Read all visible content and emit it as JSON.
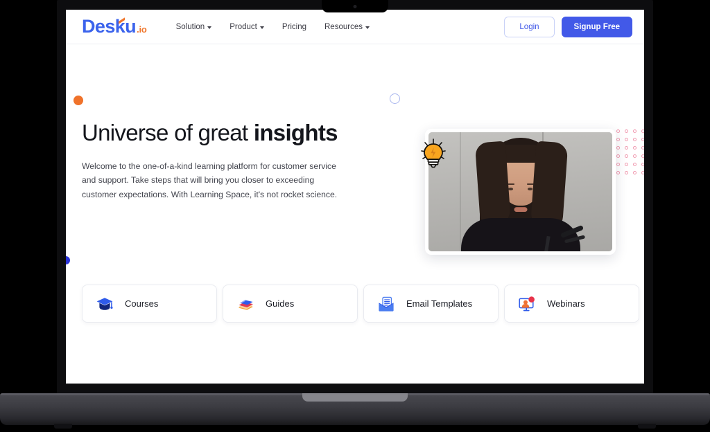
{
  "browser": {
    "device": "laptop-mockup"
  },
  "header": {
    "logo": {
      "main": "Des",
      "k": "k",
      "tail": "u",
      "suffix": ".io"
    },
    "nav": [
      {
        "label": "Solution",
        "has_caret": true
      },
      {
        "label": "Product",
        "has_caret": true
      },
      {
        "label": "Pricing",
        "has_caret": false
      },
      {
        "label": "Resources",
        "has_caret": true
      }
    ],
    "login_label": "Login",
    "signup_label": "Signup Free"
  },
  "hero": {
    "title_regular": "Universe of great ",
    "title_bold": "insights",
    "paragraph": "Welcome to the one-of-a-kind learning platform for customer service and support. Take steps that will bring you closer to exceeding customer expectations. With Learning Space, it's not rocket science."
  },
  "media": {
    "type": "video-thumbnail",
    "description": "Woman speaking at a podium with a microphone",
    "sticker": "lightbulb-icon"
  },
  "resource_cards": [
    {
      "label": "Courses",
      "icon": "graduation-cap-icon"
    },
    {
      "label": "Guides",
      "icon": "books-stack-icon"
    },
    {
      "label": "Email Templates",
      "icon": "email-envelope-icon"
    },
    {
      "label": "Webinars",
      "icon": "webinar-monitor-icon"
    }
  ],
  "decorations": {
    "orange_dot": "#f0722a",
    "blue_dot": "#2a33d8",
    "blue_ring": "#a9b6ee",
    "dot_grid": "#f09ab0"
  },
  "colors": {
    "brand_blue": "#4259e8",
    "brand_orange": "#f0762b",
    "text_dark": "#14161c",
    "text_body": "#44464f"
  }
}
